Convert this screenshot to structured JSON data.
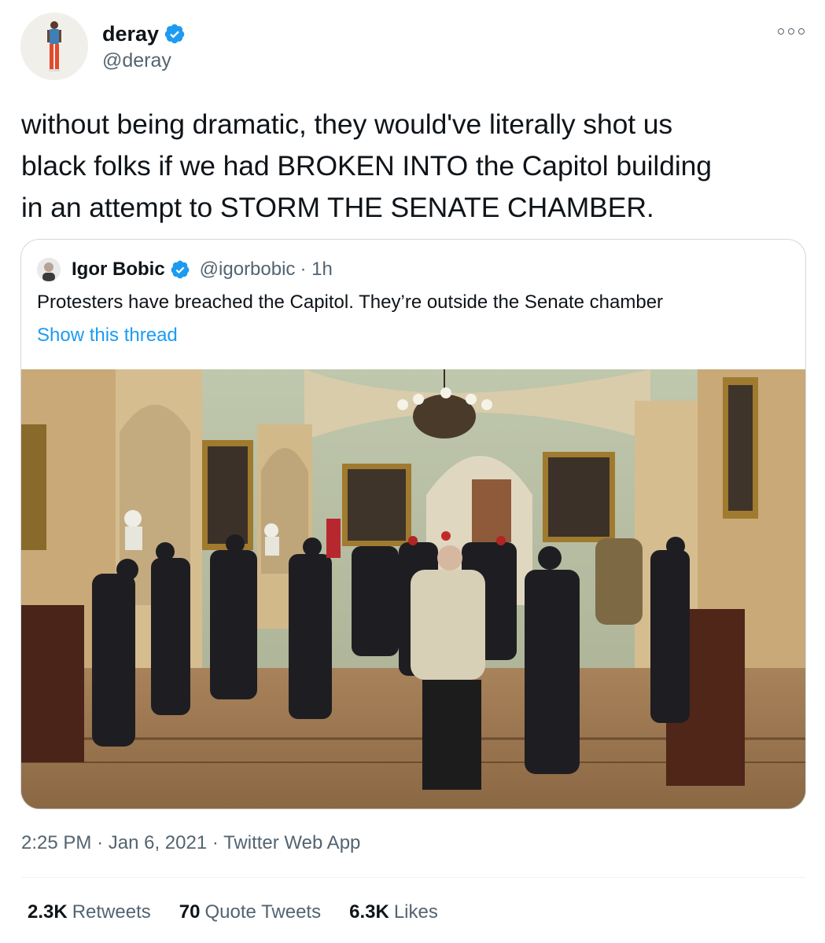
{
  "author": {
    "name": "deray",
    "handle": "@deray",
    "verified": true
  },
  "tweet_text_lines": [
    "without being dramatic, they would've literally shot us",
    "black folks if we had BROKEN INTO the Capitol building",
    "in an attempt to STORM THE SENATE CHAMBER."
  ],
  "quoted_tweet": {
    "name": "Igor Bobic",
    "handle": "@igorbobic",
    "time": "· 1h",
    "text": "Protesters have breached the Capitol. They’re outside the Senate chamber",
    "show_thread_label": "Show this thread"
  },
  "meta": {
    "time": "2:25 PM",
    "date": "Jan 6, 2021",
    "source": "Twitter Web App",
    "separator": "·"
  },
  "stats": [
    {
      "value": "2.3K",
      "label": "Retweets"
    },
    {
      "value": "70",
      "label": "Quote Tweets"
    },
    {
      "value": "6.3K",
      "label": "Likes"
    }
  ],
  "colors": {
    "verified_blue": "#1d9bf0",
    "link_blue": "#1d9bf0",
    "secondary_text": "#536471",
    "border": "#cfd9de"
  }
}
